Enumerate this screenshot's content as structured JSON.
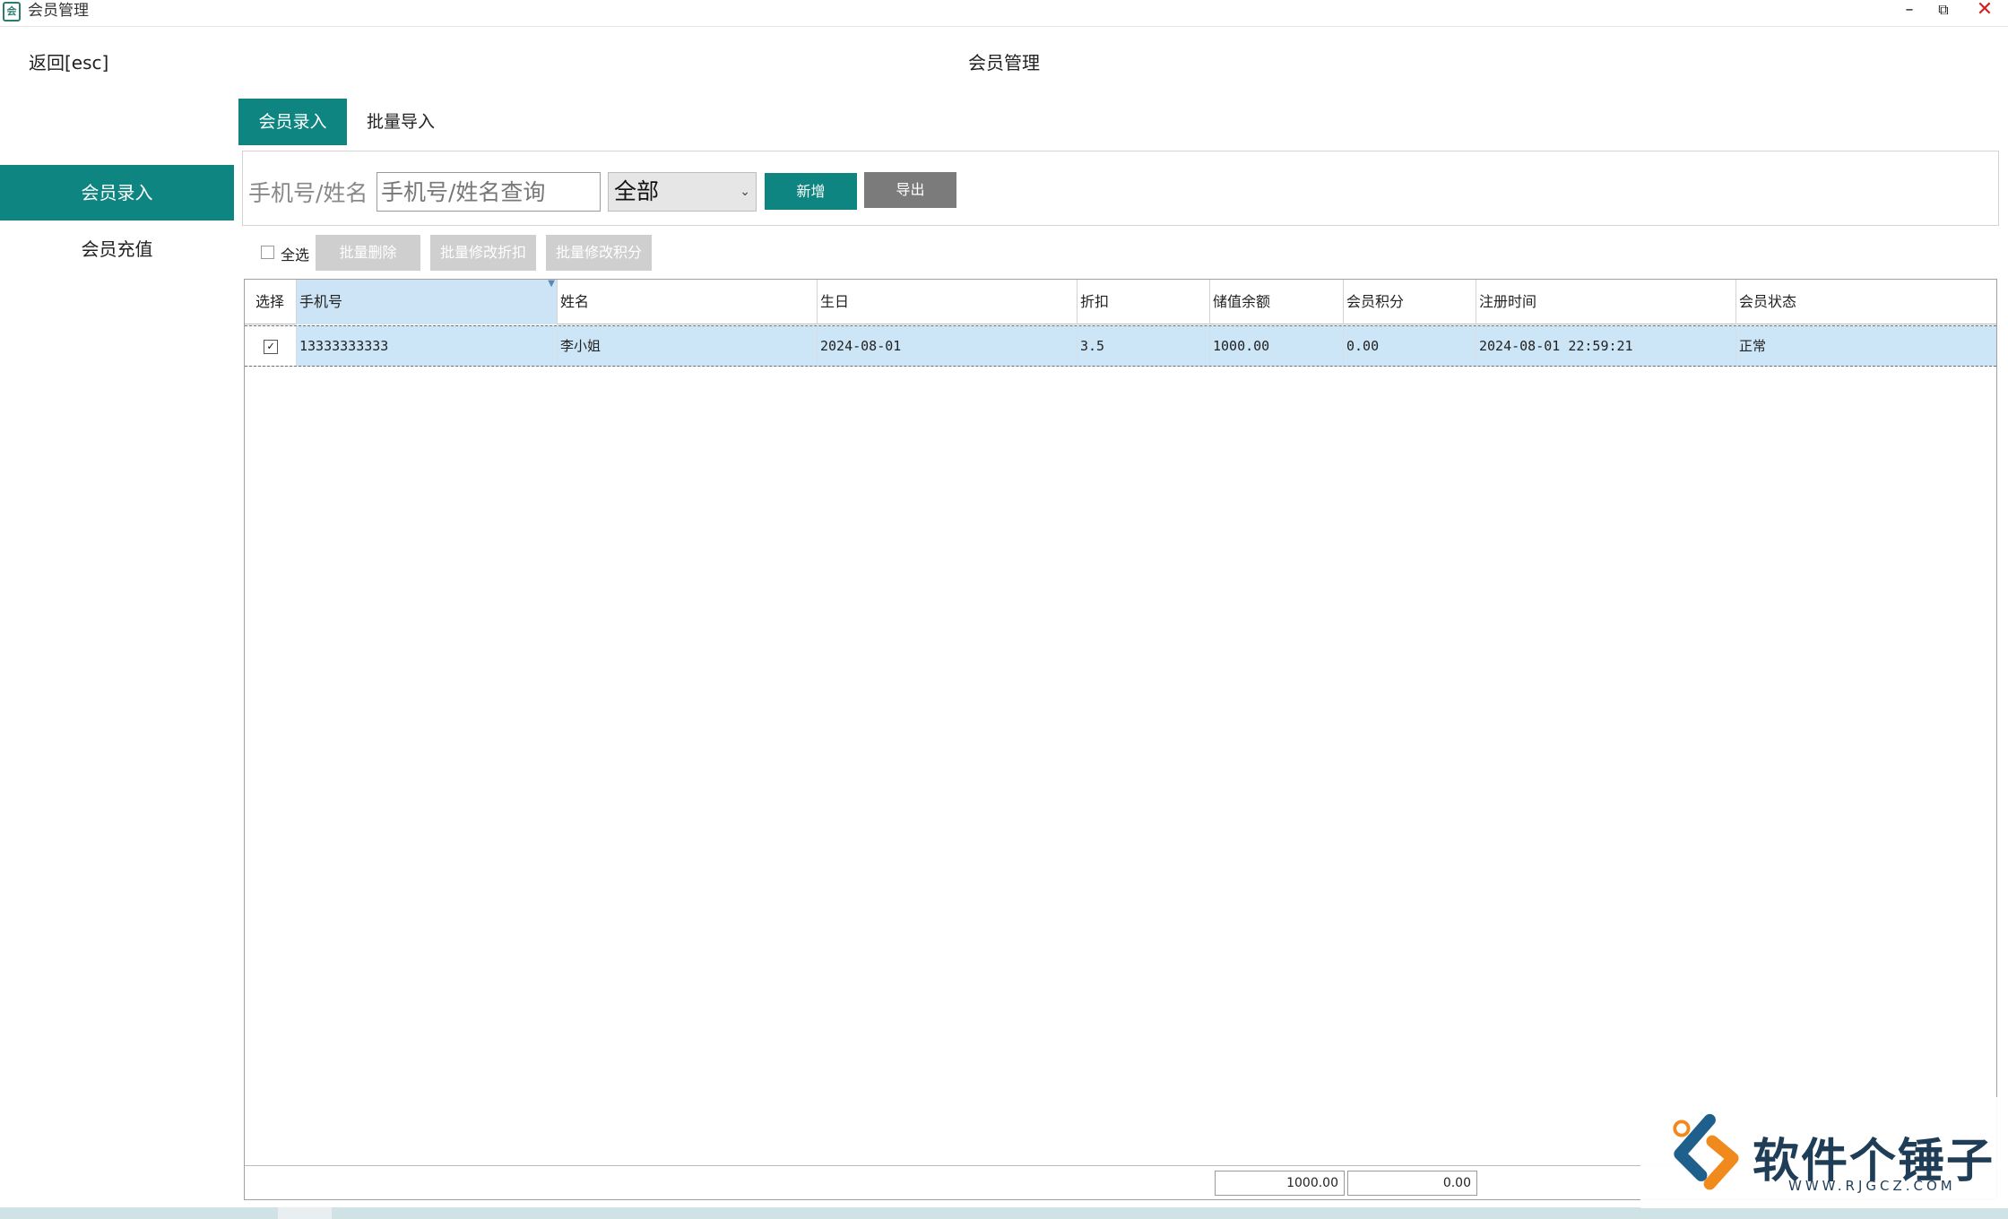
{
  "window": {
    "title": "会员管理",
    "icon_text": "会"
  },
  "header": {
    "back_label": "返回[esc]",
    "title": "会员管理"
  },
  "tabs": [
    {
      "label": "会员录入",
      "active": true
    },
    {
      "label": "批量导入",
      "active": false
    }
  ],
  "sidebar": {
    "items": [
      {
        "label": "会员录入",
        "active": true
      },
      {
        "label": "会员充值",
        "active": false
      }
    ]
  },
  "filter": {
    "label": "手机号/姓名",
    "search_placeholder": "手机号/姓名查询",
    "status_value": "全部",
    "add_label": "新增",
    "export_label": "导出"
  },
  "batch": {
    "select_all_label": "全选",
    "delete_label": "批量删除",
    "discount_label": "批量修改折扣",
    "points_label": "批量修改积分"
  },
  "table": {
    "columns": [
      "选择",
      "手机号",
      "姓名",
      "生日",
      "折扣",
      "储值余额",
      "会员积分",
      "注册时间",
      "会员状态"
    ],
    "rows": [
      {
        "selected": true,
        "phone": "13333333333",
        "name": "李小姐",
        "birthday": "2024-08-01",
        "discount": "3.5",
        "balance": "1000.00",
        "points": "0.00",
        "registered": "2024-08-01 22:59:21",
        "status": "正常"
      }
    ],
    "totals": {
      "balance": "1000.00",
      "points": "0.00"
    }
  },
  "watermark": {
    "text": "软件个锤子",
    "url": "WWW.RJGCZ.COM"
  },
  "colors": {
    "accent": "#0e8580",
    "row_highlight": "#cde6f7",
    "close": "#d42020"
  },
  "icons": {
    "sort": "sort-indicator-icon",
    "dropdown": "chevron-down-icon",
    "check": "check-icon"
  }
}
